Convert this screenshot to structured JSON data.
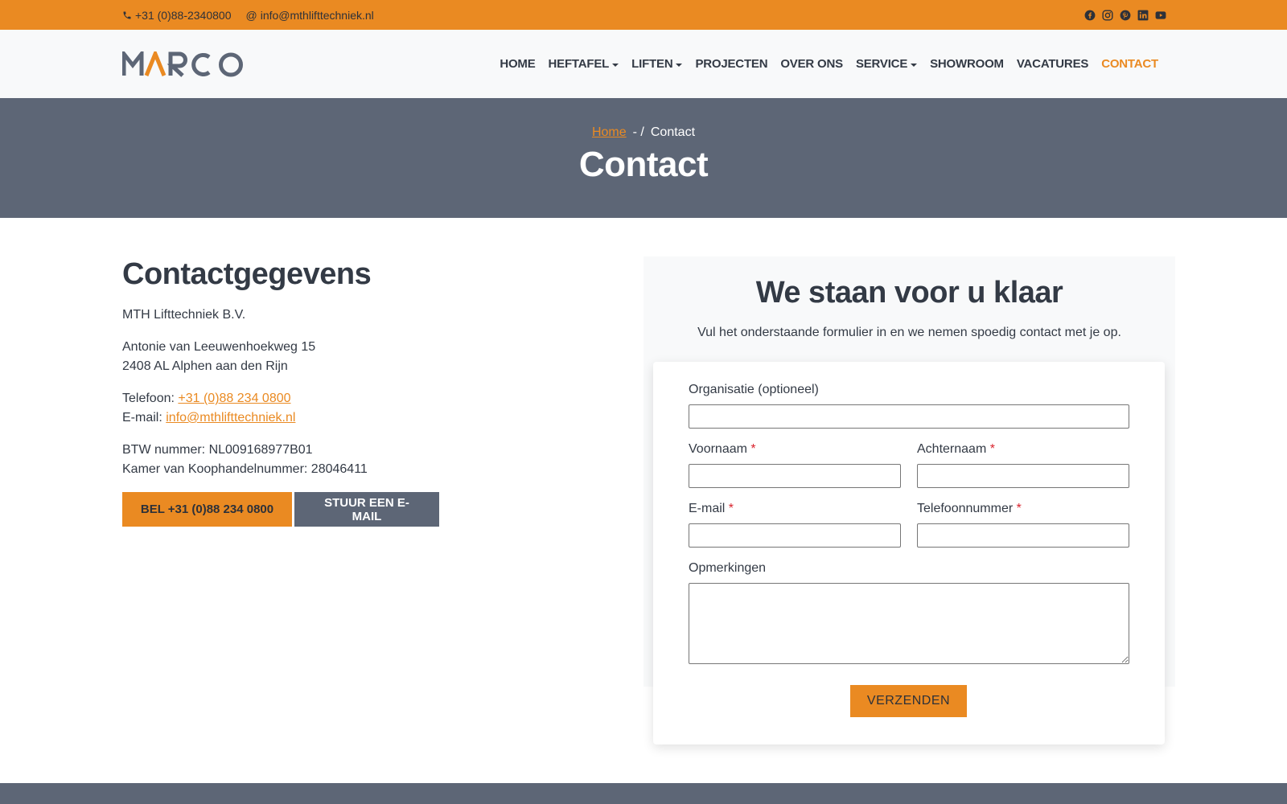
{
  "topbar": {
    "phone": "+31 (0)88-2340800",
    "email": "info@mthlifttechniek.nl",
    "social_icons": [
      "facebook-icon",
      "instagram-icon",
      "pinterest-icon",
      "linkedin-icon",
      "youtube-icon"
    ]
  },
  "header": {
    "logo_text": "MARCO",
    "nav": [
      {
        "label": "HOME",
        "dropdown": false
      },
      {
        "label": "HEFTAFEL",
        "dropdown": true
      },
      {
        "label": "LIFTEN",
        "dropdown": true
      },
      {
        "label": "PROJECTEN",
        "dropdown": false
      },
      {
        "label": "OVER ONS",
        "dropdown": false
      },
      {
        "label": "SERVICE",
        "dropdown": true
      },
      {
        "label": "SHOWROOM",
        "dropdown": false
      },
      {
        "label": "VACATURES",
        "dropdown": false
      },
      {
        "label": "CONTACT",
        "dropdown": false,
        "active": true
      }
    ]
  },
  "banner": {
    "breadcrumb_home": "Home",
    "breadcrumb_sep": "- /",
    "breadcrumb_current": "Contact",
    "title": "Contact"
  },
  "contact_info": {
    "heading": "Contactgegevens",
    "company": "MTH Lifttechniek B.V.",
    "street": "Antonie van Leeuwenhoekweg 15",
    "city": "2408 AL Alphen aan den Rijn",
    "phone_label": "Telefoon:",
    "phone": "+31 (0)88 234 0800",
    "email_label": "E-mail:",
    "email": "info@mthlifttechniek.nl",
    "vat": "BTW nummer: NL009168977B01",
    "coc": "Kamer van Koophandelnummer: 28046411",
    "call_button": "BEL +31 (0)88 234 0800",
    "mail_button": "STUUR EEN E-MAIL"
  },
  "form": {
    "heading": "We staan voor u klaar",
    "intro": "Vul het onderstaande formulier in en we nemen spoedig contact met je op.",
    "organisation_label": "Organisatie (optioneel)",
    "firstname_label": "Voornaam",
    "lastname_label": "Achternaam",
    "email_label": "E-mail",
    "phone_label": "Telefoonnummer",
    "remarks_label": "Opmerkingen",
    "required_mark": "*",
    "submit_label": "VERZENDEN"
  },
  "colors": {
    "accent": "#ea8a22",
    "slate": "#5d6676",
    "text": "#333a45",
    "required": "#d9232d"
  }
}
